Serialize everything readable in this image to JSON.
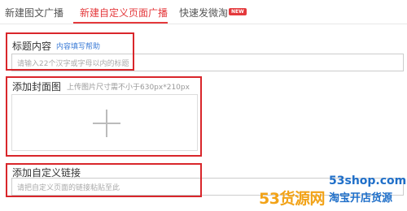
{
  "tabs": [
    {
      "label": "新建图文广播",
      "active": false
    },
    {
      "label": "新建自定义页面广播",
      "active": true
    },
    {
      "label": "快速发微淘",
      "active": false,
      "badge": "NEW"
    }
  ],
  "accent_color": "#e4393c",
  "annotation_color": "#d9262b",
  "title_section": {
    "label": "标题内容",
    "help_link": "内容填写帮助",
    "placeholder": "请输入22个汉字或字母以内的标题"
  },
  "cover_section": {
    "label": "添加封面图",
    "hint": "上传图片尺寸需不小于630px*210px",
    "upload_icon": "plus-icon"
  },
  "link_section": {
    "label": "添加自定义链接",
    "placeholder": "请把自定义页面的链接粘贴至此"
  },
  "watermark": {
    "logo": "53货源网",
    "site": "53shop.com",
    "tagline": "淘宝开店货源"
  }
}
